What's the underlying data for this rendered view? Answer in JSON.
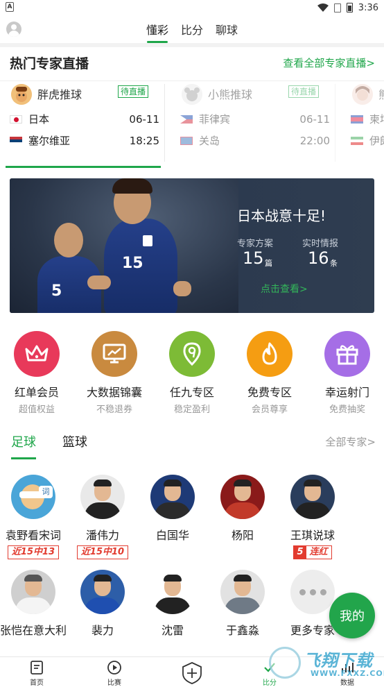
{
  "status_bar": {
    "time": "3:36",
    "left_badge": "A"
  },
  "top_tabs": [
    {
      "label": "懂彩",
      "active": true
    },
    {
      "label": "比分",
      "active": false
    },
    {
      "label": "聊球",
      "active": false
    }
  ],
  "hot_live": {
    "title": "热门专家直播",
    "more_link": "查看全部专家直播>",
    "cards": [
      {
        "expert": "胖虎推球",
        "badge": "待直播",
        "home": "日本",
        "away": "塞尔维亚",
        "date": "06-11",
        "time": "18:25"
      },
      {
        "expert": "小熊推球",
        "badge": "待直播",
        "home": "菲律宾",
        "away": "关岛",
        "date": "06-11",
        "time": "22:00"
      },
      {
        "expert": "熊",
        "badge": "",
        "home": "柬埔",
        "away": "伊朗",
        "date": "",
        "time": ""
      }
    ]
  },
  "banner": {
    "title": "日本战意十足!",
    "stat1_label": "专家方案",
    "stat1_value": "15",
    "stat1_unit": "篇",
    "stat2_label": "实时情报",
    "stat2_value": "16",
    "stat2_unit": "条",
    "cta": "点击查看>",
    "jersey_number_left": "5",
    "jersey_number_main": "15"
  },
  "features": [
    {
      "label": "红单会员",
      "sub": "超值权益",
      "icon": "crown-icon",
      "color": "#e8395a"
    },
    {
      "label": "大数据锦囊",
      "sub": "不稳退券",
      "icon": "chart-board-icon",
      "color": "#c98a3f"
    },
    {
      "label": "任九专区",
      "sub": "稳定盈利",
      "icon": "nine-icon",
      "color": "#7dbb36"
    },
    {
      "label": "免费专区",
      "sub": "会员尊享",
      "icon": "flame-icon",
      "color": "#f59d12"
    },
    {
      "label": "幸运射门",
      "sub": "免费抽奖",
      "icon": "gift-icon",
      "color": "#a56ee6"
    }
  ],
  "sport_tabs": {
    "items": [
      {
        "label": "足球",
        "active": true
      },
      {
        "label": "篮球",
        "active": false
      }
    ],
    "more": "全部专家>"
  },
  "experts_row1": [
    {
      "name": "袁野看宋词",
      "tag": "近15中13",
      "streak_num": "",
      "streak_text": ""
    },
    {
      "name": "潘伟力",
      "tag": "近15中10",
      "streak_num": "",
      "streak_text": ""
    },
    {
      "name": "白国华",
      "tag": "",
      "streak_num": "",
      "streak_text": ""
    },
    {
      "name": "杨阳",
      "tag": "",
      "streak_num": "",
      "streak_text": ""
    },
    {
      "name": "王琪说球",
      "tag": "",
      "streak_num": "5",
      "streak_text": "连红"
    }
  ],
  "experts_row2": [
    {
      "name": "张恺在意大利"
    },
    {
      "name": "裴力"
    },
    {
      "name": "沈雷"
    },
    {
      "name": "于鑫淼"
    },
    {
      "name": "更多专家"
    }
  ],
  "avatar_icon_text": "词",
  "fab_label": "我的",
  "bottom_nav": [
    {
      "label": "首页",
      "icon": "home-doc-icon"
    },
    {
      "label": "比赛",
      "icon": "play-icon"
    },
    {
      "label": "",
      "icon": "shield-plus-icon"
    },
    {
      "label": "比分",
      "icon": "score-icon"
    },
    {
      "label": "数据",
      "icon": "data-icon"
    }
  ],
  "watermark": {
    "title": "飞翔下载",
    "url": "WWW.FXXZ.COM"
  },
  "colors": {
    "accent": "#1fa64a",
    "red_tag": "#e23b2f"
  }
}
